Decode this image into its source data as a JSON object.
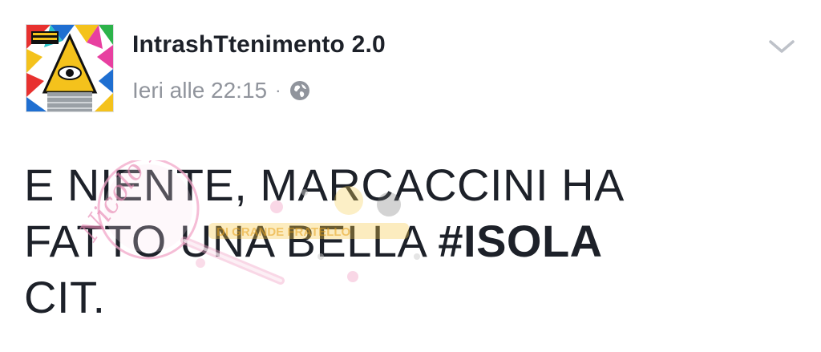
{
  "post": {
    "author": "IntrashTtenimento 2.0",
    "timestamp": "Ieri alle 22:15",
    "separator": "·",
    "privacy_icon": "globe-icon",
    "menu_icon": "chevron-down-icon",
    "text": {
      "line1": "E NIENTE, MARCACCINI HA",
      "line2_prefix": "FATTO UNA BELLA ",
      "line2_hashtag": "#ISOLA",
      "line3": "CIT."
    }
  },
  "watermark": {
    "script_text": "Nicolo News",
    "banner_text": "DI GRANDE FRATELLO"
  },
  "colors": {
    "author_text": "#1d2129",
    "meta_text": "#90949c",
    "body_text": "#1d2129",
    "chevron": "#bec2c9",
    "watermark_pink": "#f2a7c8"
  }
}
